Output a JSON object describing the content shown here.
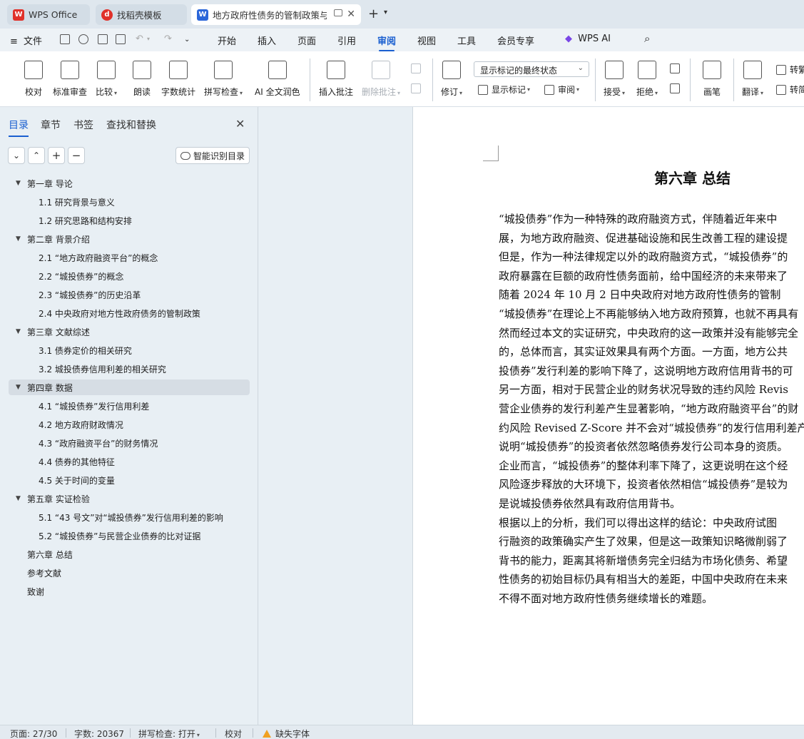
{
  "tabs": [
    {
      "label": "WPS Office",
      "icon": "wps-logo-icon",
      "color": "#e0312a"
    },
    {
      "label": "找稻壳模板",
      "icon": "docer-icon",
      "color": "#e0312a"
    },
    {
      "label": "地方政府性债务的管制政策与",
      "icon": "writer-doc-icon",
      "color": "#2b66d9"
    }
  ],
  "menu": {
    "file": "文件",
    "items": [
      "开始",
      "插入",
      "页面",
      "引用",
      "审阅",
      "视图",
      "工具",
      "会员专享"
    ],
    "active": "审阅",
    "ai": "WPS AI"
  },
  "ribbon": {
    "proofread": "校对",
    "standard_review": "标准审查",
    "compare": "比较",
    "read_aloud": "朗读",
    "word_count": "字数统计",
    "spell_check": "拼写检查",
    "ai_polish": "AI 全文润色",
    "insert_comment": "插入批注",
    "delete_comment": "删除批注",
    "track_changes": "修订",
    "show_markup_select": "显示标记的最终状态",
    "show_markup": "显示标记",
    "review": "审阅",
    "accept": "接受",
    "reject": "拒绝",
    "pen": "画笔",
    "translate": "翻译",
    "convert_trad": "转繁",
    "convert_simp": "转简"
  },
  "sidebar": {
    "tabs": [
      "目录",
      "章节",
      "书签",
      "查找和替换"
    ],
    "active_tab": "目录",
    "smart_button": "智能识别目录",
    "toc": [
      {
        "level": 1,
        "text": "第一章  导论",
        "arrow": true
      },
      {
        "level": 2,
        "text": "1.1  研究背景与意义"
      },
      {
        "level": 2,
        "text": "1.2  研究思路和结构安排"
      },
      {
        "level": 1,
        "text": "第二章  背景介绍",
        "arrow": true
      },
      {
        "level": 2,
        "text": "2.1 “地方政府融资平台”的概念"
      },
      {
        "level": 2,
        "text": "2.2 “城投债券”的概念"
      },
      {
        "level": 2,
        "text": "2.3 “城投债券”的历史沿革"
      },
      {
        "level": 2,
        "text": "2.4 中央政府对地方性政府债务的管制政策"
      },
      {
        "level": 1,
        "text": "第三章  文献综述",
        "arrow": true
      },
      {
        "level": 2,
        "text": "3.1  债券定价的相关研究"
      },
      {
        "level": 2,
        "text": "3.2  城投债券信用利差的相关研究"
      },
      {
        "level": 1,
        "text": "第四章  数据",
        "arrow": true,
        "selected": true
      },
      {
        "level": 2,
        "text": "4.1 “城投债券”发行信用利差"
      },
      {
        "level": 2,
        "text": "4.2 地方政府财政情况"
      },
      {
        "level": 2,
        "text": "4.3 “政府融资平台”的财务情况"
      },
      {
        "level": 2,
        "text": "4.4 债券的其他特征"
      },
      {
        "level": 2,
        "text": "4.5 关于时间的变量"
      },
      {
        "level": 1,
        "text": "第五章  实证检验",
        "arrow": true
      },
      {
        "level": 2,
        "text": "5.1 “43 号文”对“城投债券”发行信用利差的影响"
      },
      {
        "level": 2,
        "text": "5.2 “城投债券”与民营企业债券的比对证据"
      },
      {
        "level": 1,
        "text": "第六章  总结",
        "arrow": false
      },
      {
        "level": 1,
        "text": "参考文献",
        "arrow": false
      },
      {
        "level": 1,
        "text": "致谢",
        "arrow": false
      }
    ]
  },
  "document": {
    "title": "第六章  总结",
    "lines": [
      "    “城投债券”作为一种特殊的政府融资方式，伴随着近年来中",
      "展，为地方政府融资、促进基础设施和民生改善工程的建设提",
      "但是，作为一种法律规定以外的政府融资方式，“城投债券”的",
      "政府暴露在巨额的政府性债务面前，给中国经济的未来带来了",
      "    随着 2024 年 10 月 2 日中央政府对地方政府性债务的管制",
      "“城投债券”在理论上不再能够纳入地方政府预算，也就不再具有",
      "然而经过本文的实证研究，中央政府的这一政策并没有能够完全",
      "的，总体而言，其实证效果具有两个方面。一方面，地方公共",
      "投债券”发行利差的影响下降了，这说明地方政府信用背书的可",
      "另一方面，相对于民营企业的财务状况导致的违约风险 Revis",
      "营企业债券的发行利差产生显著影响，“地方政府融资平台”的财",
      "约风险 Revised Z-Score 并不会对“城投债券”的发行信用利差产",
      "说明“城投债券”的投资者依然忽略债券发行公司本身的资质。",
      "企业而言，“城投债券”的整体利率下降了，这更说明在这个经",
      "风险逐步释放的大环境下，投资者依然相信“城投债券”是较为",
      "是说城投债券依然具有政府信用背书。",
      "    根据以上的分析，我们可以得出这样的结论：中央政府试图",
      "行融资的政策确实产生了效果，但是这一政策知识略微削弱了",
      "背书的能力，距离其将新增债务完全归结为市场化债务、希望",
      "性债务的初始目标仍具有相当大的差距，中国中央政府在未来",
      "不得不面对地方政府性债务继续增长的难题。"
    ]
  },
  "status": {
    "page": "页面: 27/30",
    "words": "字数: 20367",
    "spell": "拼写检查: 打开",
    "proof": "校对",
    "missing_font": "缺失字体"
  },
  "colors": {
    "accent": "#1a5fd0",
    "warning": "#f0a020"
  }
}
